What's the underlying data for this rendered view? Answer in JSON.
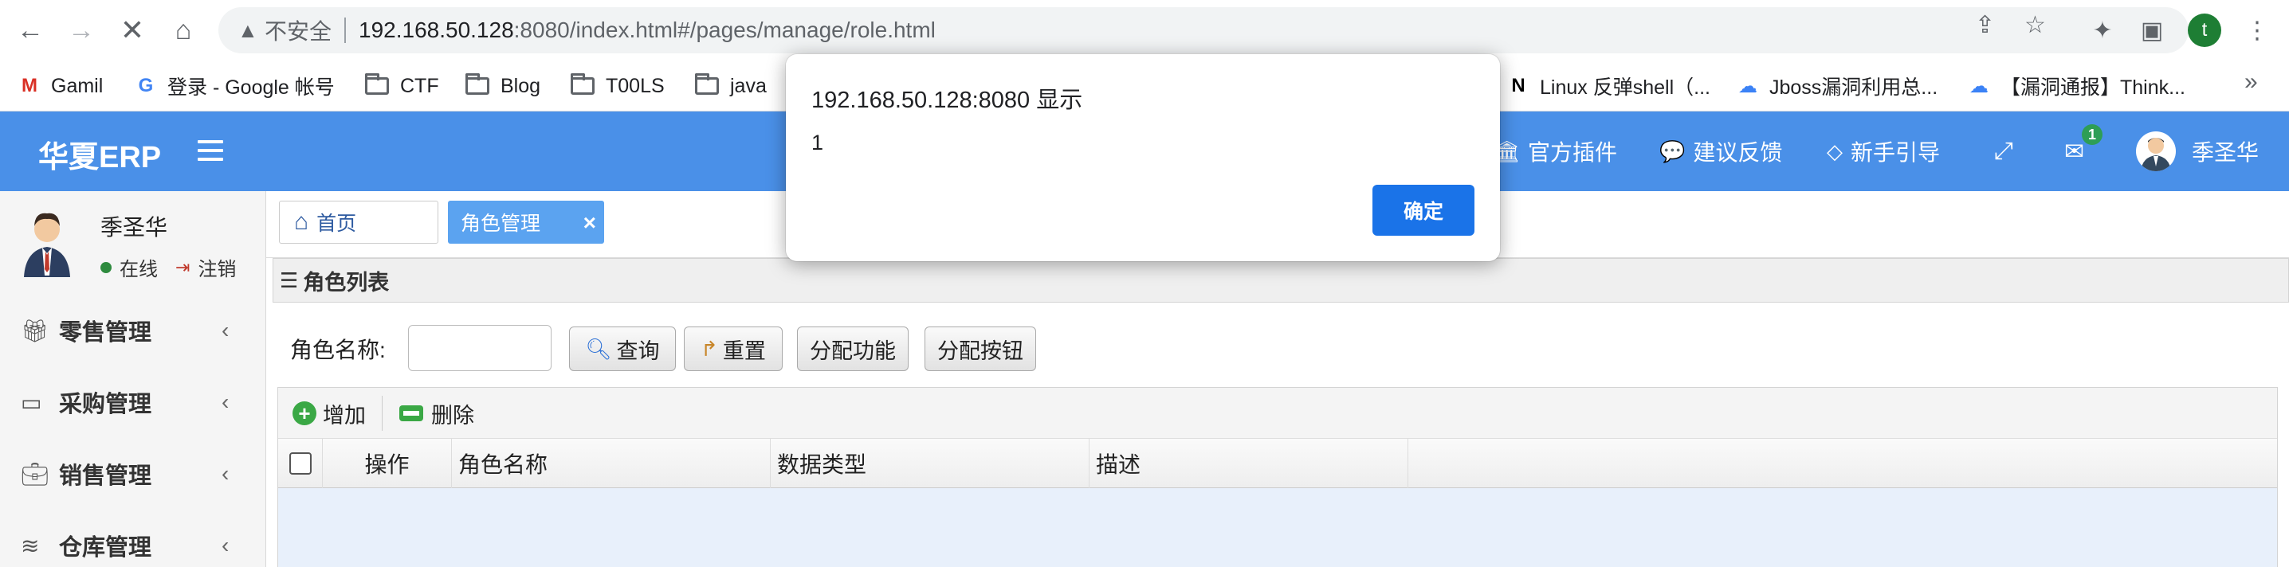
{
  "browser": {
    "security_label": "不安全",
    "url_host": "192.168.50.128",
    "url_rest": ":8080/index.html#/pages/manage/role.html",
    "profile_initial": "t",
    "bookmarks": [
      {
        "label": "Gamil",
        "icon": "gmail-icon"
      },
      {
        "label": "登录 - Google 帐号",
        "icon": "google-icon"
      },
      {
        "label": "CTF",
        "icon": "folder-icon"
      },
      {
        "label": "Blog",
        "icon": "folder-icon"
      },
      {
        "label": "T00LS",
        "icon": "folder-icon"
      },
      {
        "label": "java",
        "icon": "folder-icon"
      },
      {
        "label": "Linux 反弹shell（...",
        "icon": "notion-icon"
      },
      {
        "label": "Jboss漏洞利用总...",
        "icon": "cloud-icon"
      },
      {
        "label": "【漏洞通报】Think...",
        "icon": "cloud-icon"
      }
    ]
  },
  "app": {
    "logo": "华夏ERP",
    "header_items": {
      "plugins": "官方插件",
      "feedback": "建议反馈",
      "guide": "新手引导"
    },
    "mail_count": "1",
    "user_name": "季圣华"
  },
  "sidebar": {
    "user_name": "季圣华",
    "status_online": "在线",
    "logout": "注销",
    "items": [
      {
        "label": "零售管理",
        "icon": "gift-icon"
      },
      {
        "label": "采购管理",
        "icon": "monitor-icon"
      },
      {
        "label": "销售管理",
        "icon": "briefcase-icon"
      },
      {
        "label": "仓库管理",
        "icon": "layers-icon"
      }
    ]
  },
  "tabs": {
    "home": "首页",
    "active": "角色管理"
  },
  "panel": {
    "title": "角色列表",
    "search_label": "角色名称:",
    "search_value": "",
    "btn_query": "查询",
    "btn_reset": "重置",
    "btn_assign_func": "分配功能",
    "btn_assign_btn": "分配按钮"
  },
  "grid": {
    "btn_add": "增加",
    "btn_delete": "删除",
    "columns": [
      "操作",
      "角色名称",
      "数据类型",
      "描述"
    ]
  },
  "dialog": {
    "title": "192.168.50.128:8080 显示",
    "message": "1",
    "ok_label": "确定"
  },
  "colors": {
    "app_header": "#4a90e8",
    "active_tab": "#5ba3f0",
    "dialog_button": "#1a73e8",
    "grid_body": "#e8f0fb"
  }
}
